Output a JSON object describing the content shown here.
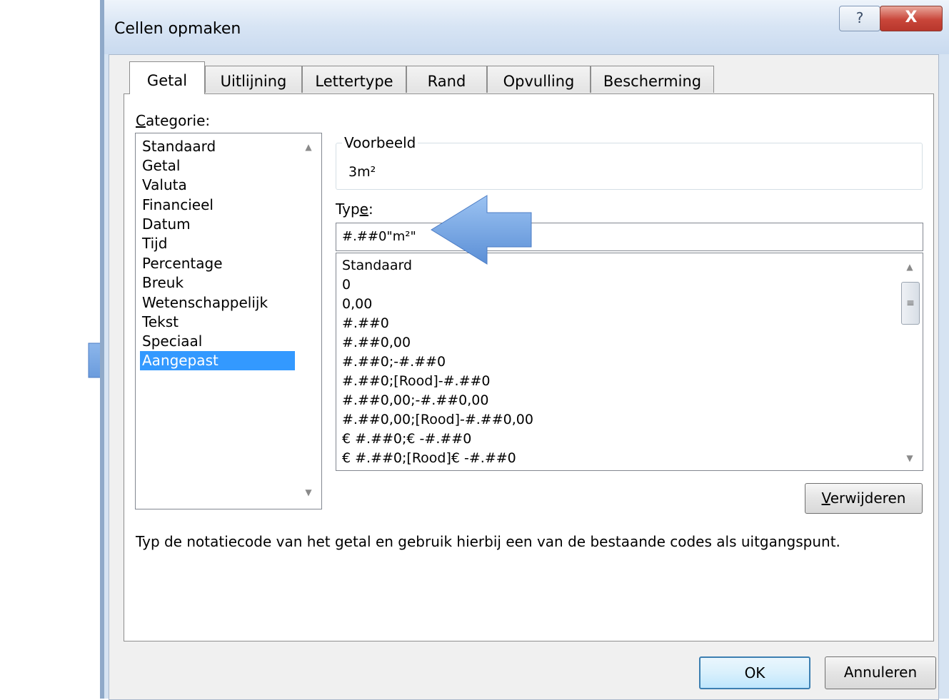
{
  "dialog": {
    "title": "Cellen opmaken",
    "help_glyph": "?",
    "close_glyph": "X"
  },
  "tabs": [
    {
      "label": "Getal",
      "active": true
    },
    {
      "label": "Uitlijning",
      "active": false
    },
    {
      "label": "Lettertype",
      "active": false
    },
    {
      "label": "Rand",
      "active": false
    },
    {
      "label": "Opvulling",
      "active": false
    },
    {
      "label": "Bescherming",
      "active": false
    }
  ],
  "category": {
    "label_mnemonic": "C",
    "label_rest": "ategorie:",
    "items": [
      "Standaard",
      "Getal",
      "Valuta",
      "Financieel",
      "Datum",
      "Tijd",
      "Percentage",
      "Breuk",
      "Wetenschappelijk",
      "Tekst",
      "Speciaal",
      "Aangepast"
    ],
    "selected": "Aangepast"
  },
  "preview": {
    "legend": "Voorbeeld",
    "value": "3m²"
  },
  "type": {
    "label_pre": "Typ",
    "label_mnemonic": "e",
    "label_post": ":",
    "value": "#.##0\"m²\"",
    "items": [
      "Standaard",
      "0",
      "0,00",
      "#.##0",
      "#.##0,00",
      "#.##0;-#.##0",
      "#.##0;[Rood]-#.##0",
      "#.##0,00;-#.##0,00",
      "#.##0,00;[Rood]-#.##0,00",
      "€ #.##0;€ -#.##0",
      "€ #.##0;[Rood]€ -#.##0"
    ]
  },
  "buttons": {
    "delete_mnemonic": "V",
    "delete_rest": "erwijderen",
    "ok": "OK",
    "cancel": "Annuleren"
  },
  "description": "Typ de notatiecode van het getal en gebruik hierbij een van de bestaande codes als uitgangspunt.",
  "colors": {
    "selection": "#3399ff",
    "arrow_fill": "#6a9fe0",
    "arrow_stroke": "#3f6fb5"
  }
}
